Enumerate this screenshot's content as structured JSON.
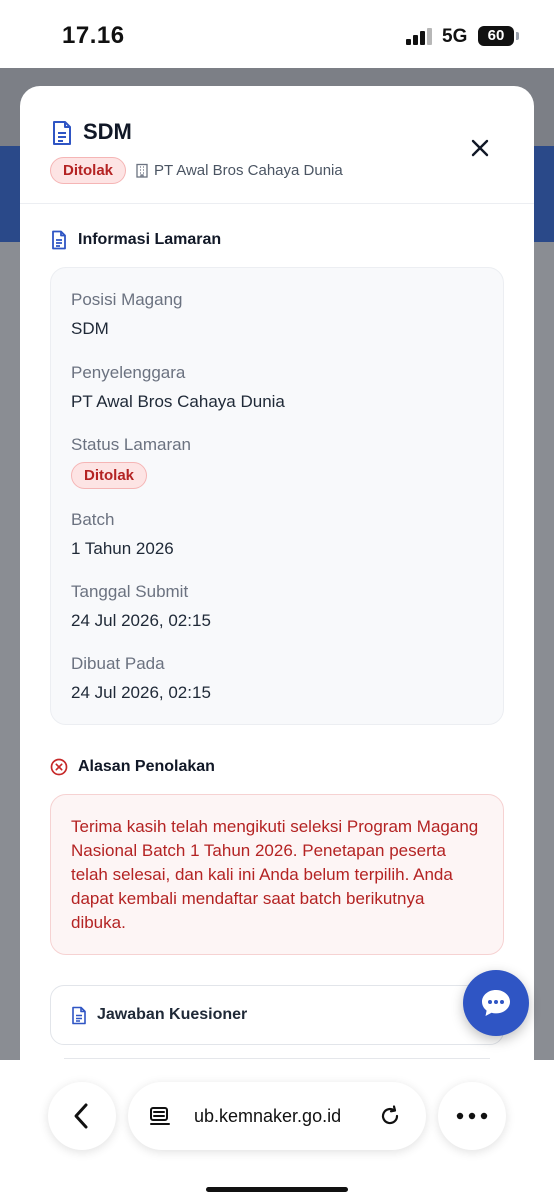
{
  "status_bar": {
    "time": "17.16",
    "network": "5G",
    "battery": "60"
  },
  "modal": {
    "title": "SDM",
    "status_badge": "Ditolak",
    "organizer": "PT Awal Bros Cahaya Dunia",
    "info_section": {
      "heading": "Informasi Lamaran",
      "fields": [
        {
          "label": "Posisi Magang",
          "value": "SDM"
        },
        {
          "label": "Penyelenggara",
          "value": "PT Awal Bros Cahaya Dunia"
        },
        {
          "label": "Status Lamaran",
          "value": "Ditolak"
        },
        {
          "label": "Batch",
          "value": "1 Tahun 2026"
        },
        {
          "label": "Tanggal Submit",
          "value": "24 Jul 2026, 02:15"
        },
        {
          "label": "Dibuat Pada",
          "value": "24 Jul 2026, 02:15"
        }
      ]
    },
    "rejection_section": {
      "heading": "Alasan Penolakan",
      "text": "Terima kasih telah mengikuti seleksi Program Magang Nasional Batch 1 Tahun 2026. Penetapan peserta telah selesai, dan kali ini Anda belum terpilih. Anda dapat kembali mendaftar saat batch berikutnya dibuka."
    },
    "questionnaire_label": "Jawaban Kuesioner"
  },
  "browser": {
    "url": "ub.kemnaker.go.id"
  },
  "colors": {
    "accent": "#2f55c4",
    "danger": "#b42323",
    "danger_bg": "#fde4e4"
  },
  "icons": [
    "document-icon",
    "building-icon",
    "close-icon",
    "x-circle-icon",
    "chat-icon",
    "back-arrow-icon",
    "tabs-icon",
    "reload-icon",
    "more-icon"
  ]
}
